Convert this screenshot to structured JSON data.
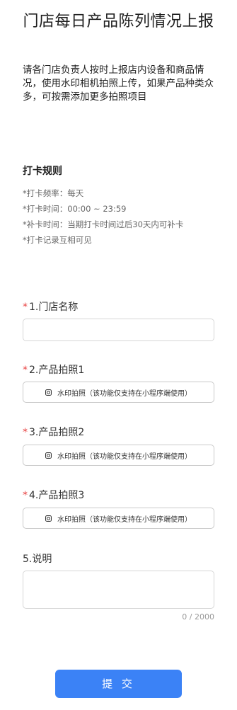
{
  "form": {
    "title": "门店每日产品陈列情况上报",
    "description": "请各门店负责人按时上报店内设备和商品情况，使用水印相机拍照上传，如果产品种类众多，可按需添加更多拍照项目"
  },
  "rules": {
    "title": "打卡规则",
    "items": [
      "*打卡频率：每天",
      "*打卡时间：00:00 ~ 23:59",
      "*补卡时间：当期打卡时间过后30天内可补卡",
      "*打卡记录互相可见"
    ]
  },
  "questions": [
    {
      "required": true,
      "marker": "*",
      "label": "1.门店名称",
      "value": ""
    },
    {
      "required": true,
      "marker": "*",
      "label": "2.产品拍照1",
      "button": "水印拍照（该功能仅支持在小程序端使用）"
    },
    {
      "required": true,
      "marker": "*",
      "label": "3.产品拍照2",
      "button": "水印拍照（该功能仅支持在小程序端使用）"
    },
    {
      "required": true,
      "marker": "*",
      "label": "4.产品拍照3",
      "button": "水印拍照（该功能仅支持在小程序端使用）"
    },
    {
      "required": false,
      "label": "5.说明",
      "value": "",
      "counter": "0 / 2000"
    }
  ],
  "submit_label": "提 交",
  "icons": {
    "camera": "camera-icon"
  },
  "colors": {
    "primary": "#3b82f6",
    "required": "#e84141",
    "muted": "#999999"
  }
}
